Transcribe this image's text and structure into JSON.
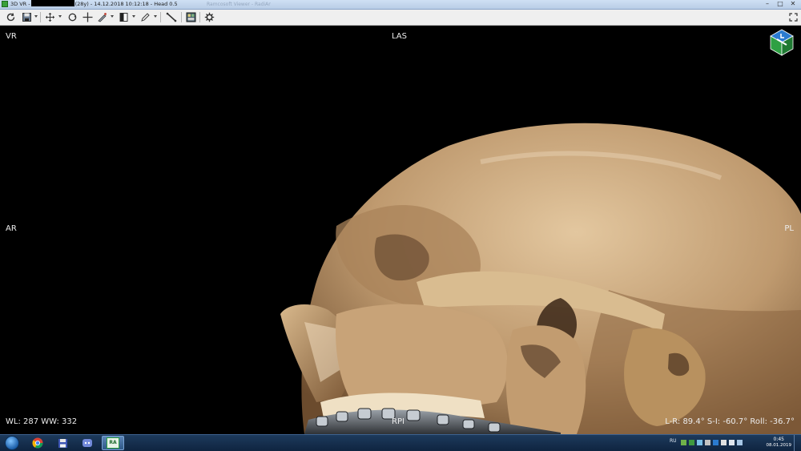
{
  "window": {
    "title_prefix": "3D VR -",
    "title_suffix": "(28y) - 14.12.2018 10:12:18 - Head 0.5",
    "ghost_tab": "Ramcosoft Viewer - RadiAnt",
    "controls": {
      "minimize": "–",
      "maximize": "□",
      "close": "✕"
    }
  },
  "toolbar": {
    "tools": [
      "refresh-icon",
      "save-icon",
      "pan-icon",
      "rotate-icon",
      "crosshair-icon",
      "scalpel-icon",
      "window-level-icon",
      "pen-icon",
      "ruler-icon",
      "mpr-icon",
      "settings-icon"
    ]
  },
  "viewport": {
    "overlay": {
      "top_left": "VR",
      "top_center": "LAS",
      "mid_left": "AR",
      "mid_right": "PL",
      "bottom_left": "WL: 287 WW: 332",
      "bottom_center": "RPI",
      "bottom_right": "L-R: 89.4° S-I: -60.7° Roll: -36.7°"
    },
    "orientation_cube": {
      "colors": {
        "face_top": "#2b7bd0",
        "face_front": "#2ea043",
        "edge": "#ffffff"
      }
    }
  },
  "taskbar": {
    "apps": [
      {
        "name": "chrome",
        "label": ""
      },
      {
        "name": "save-disk",
        "label": ""
      },
      {
        "name": "discord",
        "label": ""
      },
      {
        "name": "radiant",
        "label": "RA"
      }
    ],
    "tray": {
      "language": "RU",
      "time": "0:45",
      "date": "08.01.2019"
    }
  },
  "colors": {
    "accent": "#2ea043",
    "taskbar": "#163252",
    "bone": "#c9a57b"
  }
}
